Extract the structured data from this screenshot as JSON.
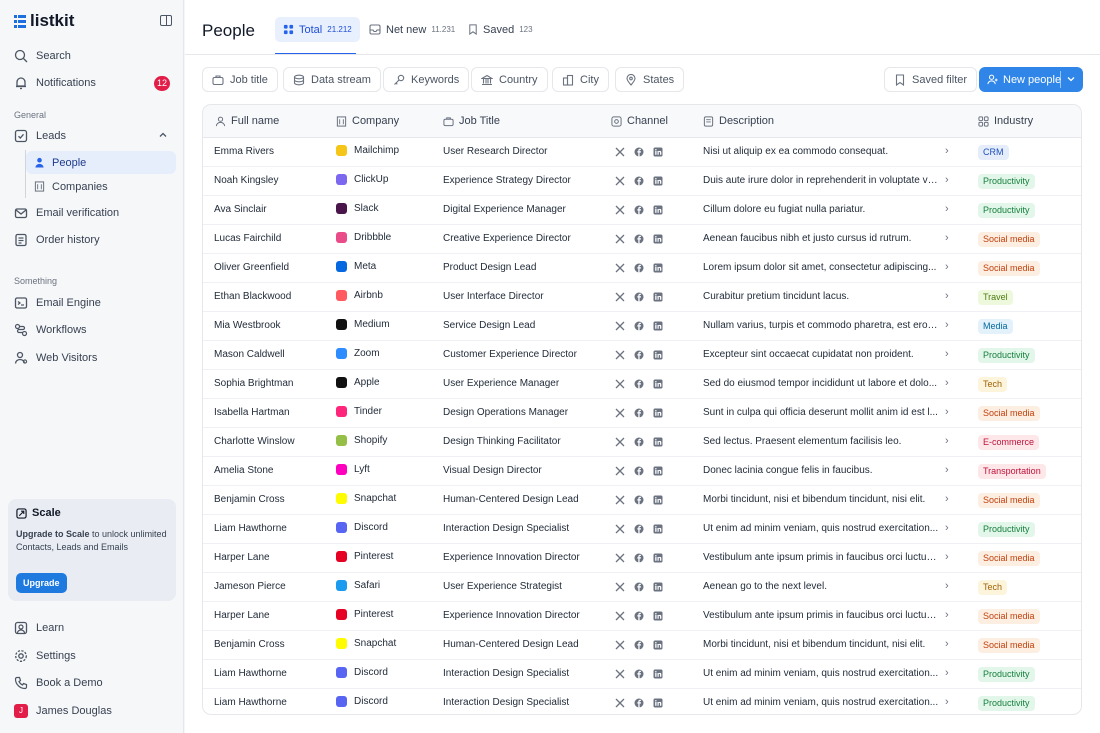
{
  "brand": {
    "name": "listkit"
  },
  "sidebar": {
    "top": [
      {
        "label": "Search",
        "icon": "search-icon"
      },
      {
        "label": "Notifications",
        "icon": "bell-icon",
        "badge": "12"
      }
    ],
    "section_general": "General",
    "leads": {
      "label": "Leads",
      "icon": "leads-icon"
    },
    "lead_subitems": [
      {
        "label": "People",
        "icon": "person-icon",
        "active": true
      },
      {
        "label": "Companies",
        "icon": "building-icon",
        "active": false
      }
    ],
    "general_items": [
      {
        "label": "Email verification",
        "icon": "mail-icon"
      },
      {
        "label": "Order history",
        "icon": "receipt-icon"
      }
    ],
    "section_something": "Something",
    "something_items": [
      {
        "label": "Email Engine",
        "icon": "terminal-icon"
      },
      {
        "label": "Workflows",
        "icon": "workflow-icon"
      },
      {
        "label": "Web Visitors",
        "icon": "visitors-icon"
      }
    ],
    "upgrade": {
      "title": "Scale",
      "bold": "Upgrade to Scale",
      "text": " to unlock unlimited Contacts, Leads and Emails",
      "button": "Upgrade"
    },
    "bottom": [
      {
        "label": "Learn",
        "icon": "learn-icon"
      },
      {
        "label": "Settings",
        "icon": "gear-icon"
      },
      {
        "label": "Book a Demo",
        "icon": "phone-icon"
      }
    ],
    "user": {
      "name": "James Douglas",
      "initial": "J"
    }
  },
  "header": {
    "title": "People",
    "tabs": [
      {
        "label": "Total",
        "count": "21.212",
        "active": true
      },
      {
        "label": "Net new",
        "count": "11.231",
        "active": false
      },
      {
        "label": "Saved",
        "count": "123",
        "active": false
      }
    ]
  },
  "filters": [
    "Job title",
    "Data stream",
    "Keywords",
    "Country",
    "City",
    "States"
  ],
  "saved_filter": "Saved filter",
  "new_people": "New people",
  "columns": [
    "Full name",
    "Company",
    "Job Title",
    "Channel",
    "Description",
    "Industry"
  ],
  "industry_colors": {
    "CRM": [
      "#e5edfb",
      "#1e4fb8"
    ],
    "Productivity": [
      "#e3f6ea",
      "#15803d"
    ],
    "Social media": [
      "#fdeee2",
      "#c2410c"
    ],
    "Travel": [
      "#eef8dd",
      "#4d7c0f"
    ],
    "Media": [
      "#e3f1fb",
      "#0369a1"
    ],
    "Tech": [
      "#fdf4dc",
      "#a16207"
    ],
    "E-commerce": [
      "#fde7e9",
      "#be123c"
    ],
    "Transportation": [
      "#fde7e9",
      "#be123c"
    ]
  },
  "rows": [
    {
      "name": "Emma Rivers",
      "company": "Mailchimp",
      "logo": "#f5c518",
      "job": "User Research Director",
      "desc": "Nisi ut aliquip ex ea commodo consequat.",
      "industry": "CRM"
    },
    {
      "name": "Noah Kingsley",
      "company": "ClickUp",
      "logo": "#7b68ee",
      "job": "Experience Strategy Director",
      "desc": "Duis aute irure dolor in reprehenderit in voluptate ve...",
      "industry": "Productivity"
    },
    {
      "name": "Ava Sinclair",
      "company": "Slack",
      "logo": "#4a154b",
      "job": "Digital Experience Manager",
      "desc": "Cillum dolore eu fugiat nulla pariatur.",
      "industry": "Productivity"
    },
    {
      "name": "Lucas Fairchild",
      "company": "Dribbble",
      "logo": "#ea4c89",
      "job": "Creative Experience Director",
      "desc": "Aenean faucibus nibh et justo cursus id rutrum.",
      "industry": "Social media"
    },
    {
      "name": "Oliver Greenfield",
      "company": "Meta",
      "logo": "#0668e1",
      "job": "Product Design Lead",
      "desc": "Lorem ipsum dolor sit amet, consectetur adipiscing...",
      "industry": "Social media"
    },
    {
      "name": "Ethan Blackwood",
      "company": "Airbnb",
      "logo": "#ff5a5f",
      "job": "User Interface Director",
      "desc": "Curabitur pretium tincidunt lacus.",
      "industry": "Travel"
    },
    {
      "name": "Mia Westbrook",
      "company": "Medium",
      "logo": "#111111",
      "job": "Service Design Lead",
      "desc": "Nullam varius, turpis et commodo pharetra, est eros...",
      "industry": "Media"
    },
    {
      "name": "Mason Caldwell",
      "company": "Zoom",
      "logo": "#2d8cff",
      "job": "Customer Experience Director",
      "desc": "Excepteur sint occaecat cupidatat non proident.",
      "industry": "Productivity"
    },
    {
      "name": "Sophia Brightman",
      "company": "Apple",
      "logo": "#111111",
      "job": "User Experience Manager",
      "desc": "Sed do eiusmod tempor incididunt ut labore et dolo...",
      "industry": "Tech"
    },
    {
      "name": "Isabella Hartman",
      "company": "Tinder",
      "logo": "#fd267a",
      "job": "Design Operations Manager",
      "desc": "Sunt in culpa qui officia deserunt mollit anim id est l...",
      "industry": "Social media"
    },
    {
      "name": "Charlotte Winslow",
      "company": "Shopify",
      "logo": "#95bf47",
      "job": "Design Thinking Facilitator",
      "desc": "Sed lectus. Praesent elementum facilisis leo.",
      "industry": "E-commerce"
    },
    {
      "name": "Amelia Stone",
      "company": "Lyft",
      "logo": "#ff00bf",
      "job": "Visual Design Director",
      "desc": "Donec lacinia congue felis in faucibus.",
      "industry": "Transportation"
    },
    {
      "name": "Benjamin Cross",
      "company": "Snapchat",
      "logo": "#fffc00",
      "job": "Human-Centered Design Lead",
      "desc": "Morbi tincidunt, nisi et bibendum tincidunt, nisi elit.",
      "industry": "Social media"
    },
    {
      "name": "Liam Hawthorne",
      "company": "Discord",
      "logo": "#5865f2",
      "job": "Interaction Design Specialist",
      "desc": "Ut enim ad minim veniam, quis nostrud exercitation...",
      "industry": "Productivity"
    },
    {
      "name": "Harper Lane",
      "company": "Pinterest",
      "logo": "#e60023",
      "job": "Experience Innovation Director",
      "desc": "Vestibulum ante ipsum primis in faucibus orci luctus...",
      "industry": "Social media"
    },
    {
      "name": "Jameson Pierce",
      "company": "Safari",
      "logo": "#1a9bf0",
      "job": "User Experience Strategist",
      "desc": "Aenean go to the next level.",
      "industry": "Tech"
    },
    {
      "name": "Harper Lane",
      "company": "Pinterest",
      "logo": "#e60023",
      "job": "Experience Innovation Director",
      "desc": "Vestibulum ante ipsum primis in faucibus orci luctus...",
      "industry": "Social media"
    },
    {
      "name": "Benjamin Cross",
      "company": "Snapchat",
      "logo": "#fffc00",
      "job": "Human-Centered Design Lead",
      "desc": "Morbi tincidunt, nisi et bibendum tincidunt, nisi elit.",
      "industry": "Social media"
    },
    {
      "name": "Liam Hawthorne",
      "company": "Discord",
      "logo": "#5865f2",
      "job": "Interaction Design Specialist",
      "desc": "Ut enim ad minim veniam, quis nostrud exercitation...",
      "industry": "Productivity"
    },
    {
      "name": "Liam Hawthorne",
      "company": "Discord",
      "logo": "#5865f2",
      "job": "Interaction Design Specialist",
      "desc": "Ut enim ad minim veniam, quis nostrud exercitation...",
      "industry": "Productivity"
    }
  ]
}
